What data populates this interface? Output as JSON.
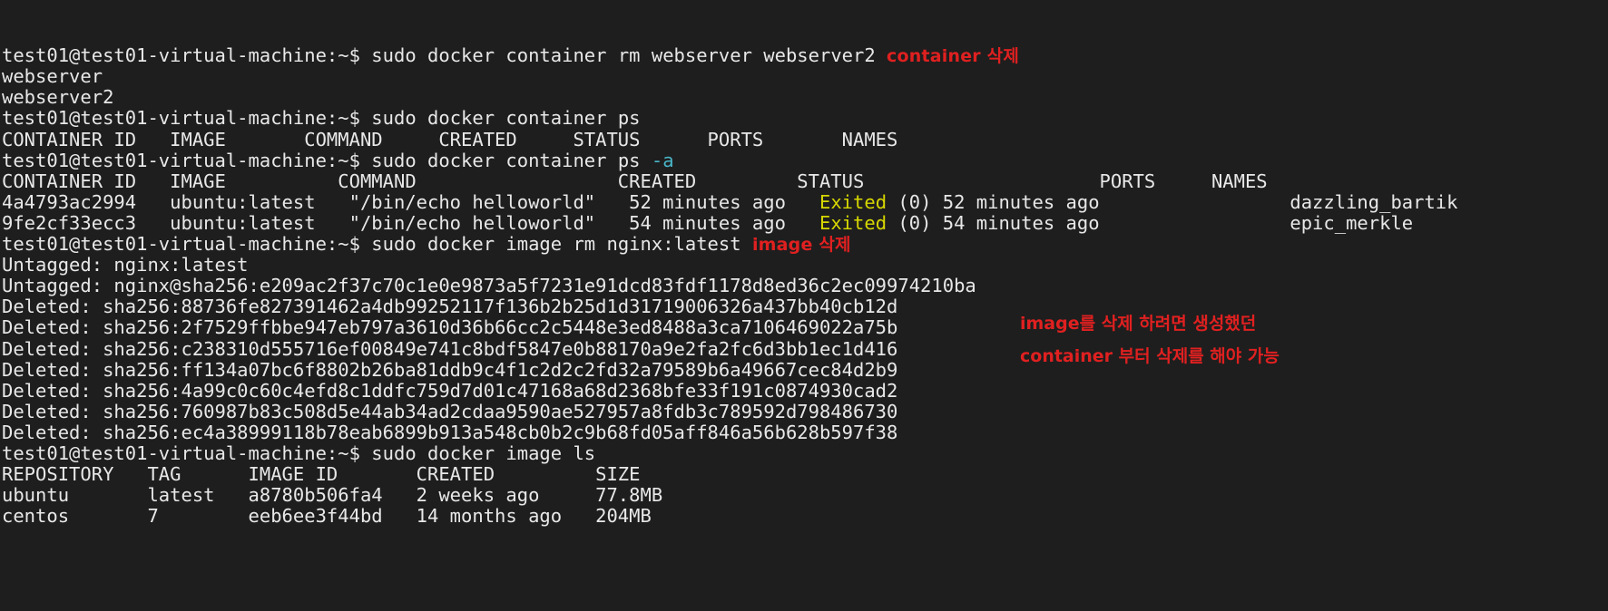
{
  "terminal": {
    "title": "test01@test01-virtual-machine: ~",
    "colors": {
      "background": "#1e1e1e",
      "foreground": "#e8e8e8",
      "cyan": "#49b6c8",
      "yellow": "#d7d700",
      "annotation_red": "#e02020"
    },
    "prompt": "test01@test01-virtual-machine:~$ ",
    "lines": [
      {
        "segments": [
          {
            "text": "test01@test01-virtual-machine:~$ ",
            "color": "default"
          },
          {
            "text": "sudo docker container rm webserver webserver2 ",
            "color": "default"
          },
          {
            "text": "container 삭제",
            "color": "red",
            "annotation": true
          }
        ]
      },
      {
        "segments": [
          {
            "text": "webserver",
            "color": "default"
          }
        ]
      },
      {
        "segments": [
          {
            "text": "webserver2",
            "color": "default"
          }
        ]
      },
      {
        "segments": [
          {
            "text": "test01@test01-virtual-machine:~$ ",
            "color": "default"
          },
          {
            "text": "sudo docker container ps",
            "color": "default"
          }
        ]
      },
      {
        "segments": [
          {
            "text": "CONTAINER ID   IMAGE       COMMAND     CREATED     STATUS      PORTS       NAMES",
            "color": "default"
          }
        ]
      },
      {
        "segments": [
          {
            "text": "test01@test01-virtual-machine:~$ ",
            "color": "default"
          },
          {
            "text": "sudo docker container ps ",
            "color": "default"
          },
          {
            "text": "-a",
            "color": "cyan"
          }
        ]
      },
      {
        "segments": [
          {
            "text": "CONTAINER ID   IMAGE          COMMAND                  CREATED         STATUS                     PORTS     NAMES",
            "color": "default"
          }
        ]
      },
      {
        "segments": [
          {
            "text": "4a4793ac2994   ubuntu:latest   \"/bin/echo helloworld\"   52 minutes ago   ",
            "color": "default"
          },
          {
            "text": "Exited",
            "color": "yellow"
          },
          {
            "text": " (0) 52 minutes ago                 dazzling_bartik",
            "color": "default"
          }
        ]
      },
      {
        "segments": [
          {
            "text": "9fe2cf33ecc3   ubuntu:latest   \"/bin/echo helloworld\"   54 minutes ago   ",
            "color": "default"
          },
          {
            "text": "Exited",
            "color": "yellow"
          },
          {
            "text": " (0) 54 minutes ago                 epic_merkle",
            "color": "default"
          }
        ]
      },
      {
        "segments": [
          {
            "text": "test01@test01-virtual-machine:~$ ",
            "color": "default"
          },
          {
            "text": "sudo docker image rm nginx:latest ",
            "color": "default"
          },
          {
            "text": "image 삭제",
            "color": "red",
            "annotation": true
          }
        ]
      },
      {
        "segments": [
          {
            "text": "Untagged: nginx:latest",
            "color": "default"
          }
        ]
      },
      {
        "segments": [
          {
            "text": "Untagged: nginx@sha256:e209ac2f37c70c1e0e9873a5f7231e91dcd83fdf1178d8ed36c2ec09974210ba",
            "color": "default"
          }
        ]
      },
      {
        "segments": [
          {
            "text": "Deleted: sha256:88736fe827391462a4db99252117f136b2b25d1d31719006326a437bb40cb12d",
            "color": "default"
          }
        ]
      },
      {
        "segments": [
          {
            "text": "Deleted: sha256:2f7529ffbbe947eb797a3610d36b66cc2c5448e3ed8488a3ca7106469022a75b",
            "color": "default"
          }
        ]
      },
      {
        "segments": [
          {
            "text": "Deleted: sha256:c238310d555716ef00849e741c8bdf5847e0b88170a9e2fa2fc6d3bb1ec1d416",
            "color": "default"
          }
        ]
      },
      {
        "segments": [
          {
            "text": "Deleted: sha256:ff134a07bc6f8802b26ba81ddb9c4f1c2d2c2fd32a79589b6a49667cec84d2b9",
            "color": "default"
          }
        ]
      },
      {
        "segments": [
          {
            "text": "Deleted: sha256:4a99c0c60c4efd8c1ddfc759d7d01c47168a68d2368bfe33f191c0874930cad2",
            "color": "default"
          }
        ]
      },
      {
        "segments": [
          {
            "text": "Deleted: sha256:760987b83c508d5e44ab34ad2cdaa9590ae527957a8fdb3c789592d798486730",
            "color": "default"
          }
        ]
      },
      {
        "segments": [
          {
            "text": "Deleted: sha256:ec4a38999118b78eab6899b913a548cb0b2c9b68fd05aff846a56b628b597f38",
            "color": "default"
          }
        ]
      },
      {
        "segments": [
          {
            "text": "test01@test01-virtual-machine:~$ ",
            "color": "default"
          },
          {
            "text": "sudo docker image ls",
            "color": "default"
          }
        ]
      },
      {
        "segments": [
          {
            "text": "REPOSITORY   TAG      IMAGE ID       CREATED         SIZE",
            "color": "default"
          }
        ]
      },
      {
        "segments": [
          {
            "text": "ubuntu       latest   a8780b506fa4   2 weeks ago     77.8MB",
            "color": "default"
          }
        ]
      },
      {
        "segments": [
          {
            "text": "centos       7        eeb6ee3f44bd   14 months ago   204MB",
            "color": "default"
          }
        ]
      }
    ],
    "annotations": [
      {
        "id": "container-delete",
        "text": "container 삭제"
      },
      {
        "id": "image-delete",
        "text": "image 삭제"
      },
      {
        "id": "image-delete-note-1",
        "text": "image를 삭제 하려면 생성했던"
      },
      {
        "id": "image-delete-note-2",
        "text": "container 부터 삭제를 해야 가능"
      }
    ],
    "commands": [
      "sudo docker container rm webserver webserver2",
      "sudo docker container ps",
      "sudo docker container ps -a",
      "sudo docker image rm nginx:latest",
      "sudo docker image ls"
    ],
    "container_ps_a_table": {
      "headers": [
        "CONTAINER ID",
        "IMAGE",
        "COMMAND",
        "CREATED",
        "STATUS",
        "PORTS",
        "NAMES"
      ],
      "rows": [
        [
          "4a4793ac2994",
          "ubuntu:latest",
          "\"/bin/echo helloworld\"",
          "52 minutes ago",
          "Exited (0) 52 minutes ago",
          "",
          "dazzling_bartik"
        ],
        [
          "9fe2cf33ecc3",
          "ubuntu:latest",
          "\"/bin/echo helloworld\"",
          "54 minutes ago",
          "Exited (0) 54 minutes ago",
          "",
          "epic_merkle"
        ]
      ]
    },
    "image_ls_table": {
      "headers": [
        "REPOSITORY",
        "TAG",
        "IMAGE ID",
        "CREATED",
        "SIZE"
      ],
      "rows": [
        [
          "ubuntu",
          "latest",
          "a8780b506fa4",
          "2 weeks ago",
          "77.8MB"
        ],
        [
          "centos",
          "7",
          "eeb6ee3f44bd",
          "14 months ago",
          "204MB"
        ]
      ]
    }
  }
}
